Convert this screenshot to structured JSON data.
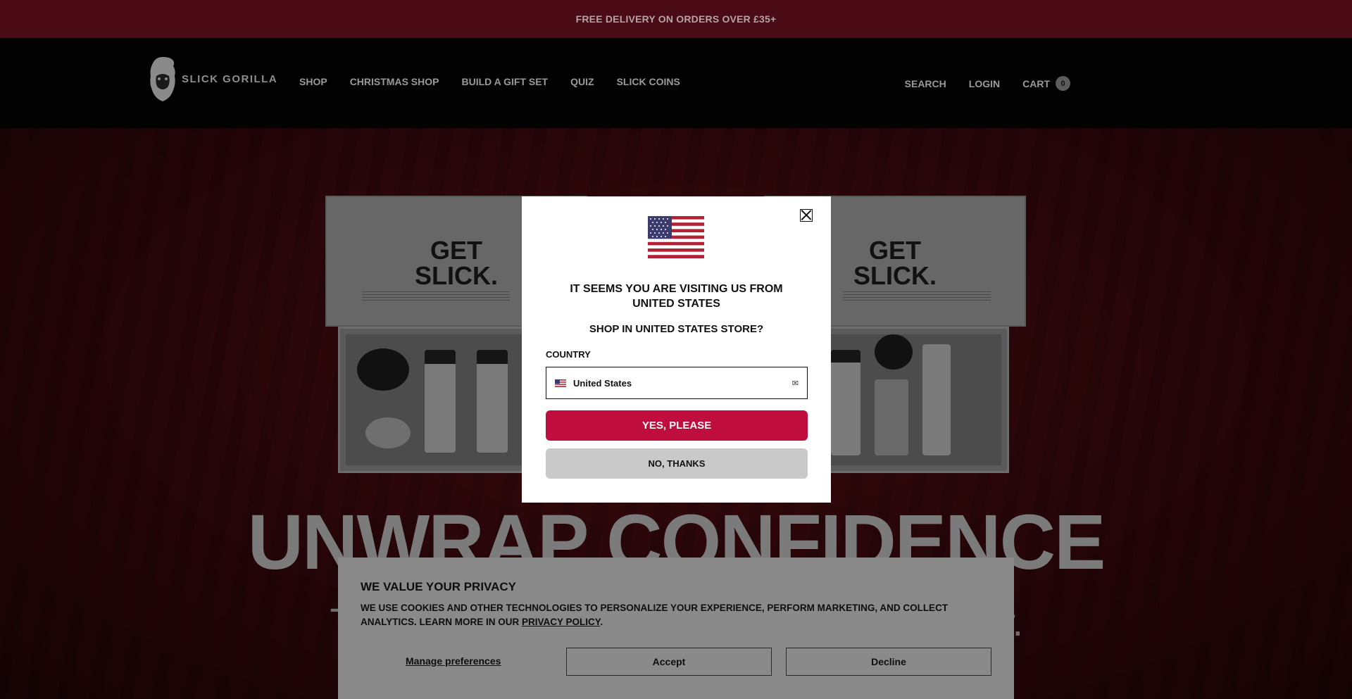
{
  "announcement": "FREE DELIVERY ON ORDERS OVER £35+",
  "header": {
    "logo_text": "SLICK GORILLA",
    "nav": [
      "SHOP",
      "CHRISTMAS SHOP",
      "BUILD A GIFT SET",
      "QUIZ",
      "SLICK COINS"
    ],
    "search_label": "SEARCH",
    "login_label": "LOGIN",
    "cart_label": "CART",
    "cart_count": "0"
  },
  "hero": {
    "box_lid_title_line1": "GET",
    "box_lid_title_line2": "SLICK.",
    "title": "UNWRAP CONFIDENCE",
    "subtitle": "Three box sets to help you craft great hair."
  },
  "geo_modal": {
    "question": "IT SEEMS YOU ARE VISITING US FROM UNITED STATES",
    "store_prompt": "SHOP IN UNITED STATES STORE?",
    "country_label": "COUNTRY",
    "country_value": "United States",
    "yes_label": "YES, PLEASE",
    "no_label": "NO, THANKS"
  },
  "cookie_banner": {
    "title": "WE VALUE YOUR PRIVACY",
    "body": "WE USE COOKIES AND OTHER TECHNOLOGIES TO PERSONALIZE YOUR EXPERIENCE, PERFORM MARKETING, AND COLLECT ANALYTICS. LEARN MORE IN OUR",
    "policy_link": "PRIVACY POLICY",
    "body_end": ".",
    "manage_label": "Manage preferences",
    "accept_label": "Accept",
    "decline_label": "Decline"
  },
  "colors": {
    "announcement_bg": "#4a0a16",
    "brand_red": "#bf0d3e",
    "header_bg": "#020202"
  },
  "icons": {
    "close": "close-icon",
    "flag": "us-flag-icon",
    "logo": "gorilla-logo-icon"
  }
}
